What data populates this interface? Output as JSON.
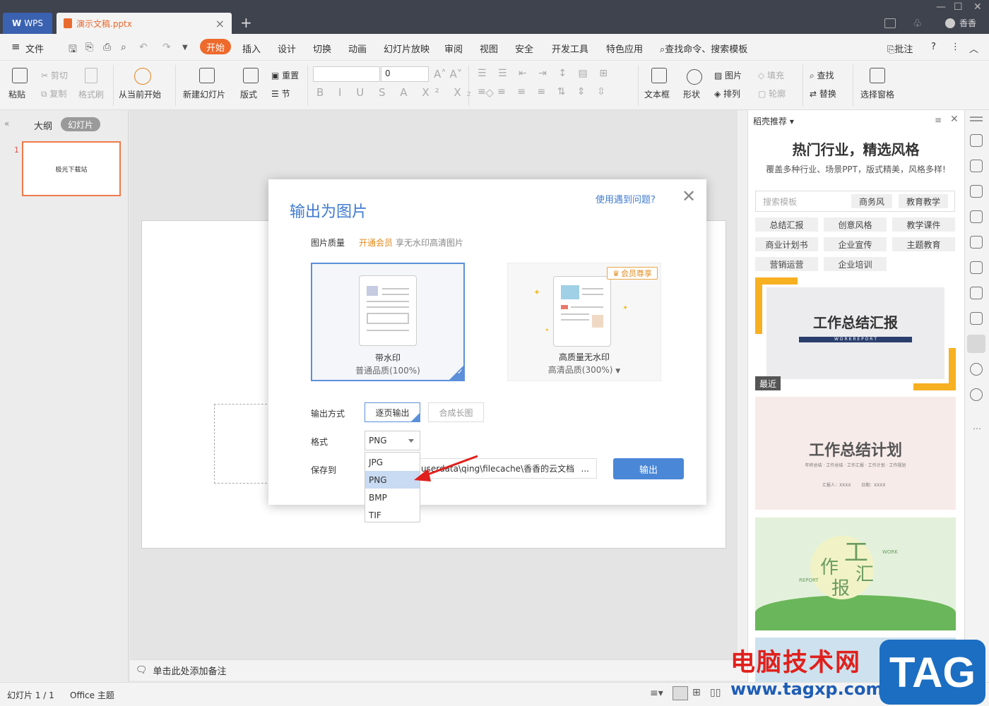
{
  "titlebar": {
    "wps_label": "WPS",
    "doc_tab": "演示文稿.pptx",
    "user": "香香"
  },
  "menu": {
    "file": "文件",
    "items": [
      "开始",
      "插入",
      "设计",
      "切换",
      "动画",
      "幻灯片放映",
      "审阅",
      "视图",
      "安全",
      "开发工具",
      "特色应用"
    ],
    "search": "查找命令、搜索模板",
    "comment": "批注"
  },
  "toolbar": {
    "paste": "粘贴",
    "cut": "剪切",
    "copy": "复制",
    "format_painter": "格式刷",
    "from_start": "从当前开始",
    "new_slide": "新建幻灯片",
    "layout": "版式",
    "reset": "重置",
    "section": "节",
    "font_size": "0",
    "textbox": "文本框",
    "shape": "形状",
    "picture": "图片",
    "arrange": "排列",
    "fill": "填充",
    "outline": "轮廓",
    "find": "查找",
    "replace": "替换",
    "select_pane": "选择窗格"
  },
  "leftpane": {
    "tab_outline": "大纲",
    "tab_slides": "幻灯片",
    "slide_num": "1",
    "thumb_text": "极光下载站"
  },
  "notes": "单击此处添加备注",
  "rightpanel": {
    "header": "稻壳推荐",
    "title": "热门行业，精选风格",
    "subtitle": "覆盖多种行业、场景PPT，版式精美，风格多样!",
    "search_placeholder": "搜索模板",
    "search_chips": [
      "商务风",
      "教育教学"
    ],
    "categories": [
      "总结汇报",
      "创意风格",
      "教学课件",
      "商业计划书",
      "企业宣传",
      "主题教育",
      "营销运营",
      "企业培训"
    ],
    "card1_title": "工作总结汇报",
    "card1_sub": "W O R K   R E P O R T",
    "card1_badge": "最近",
    "card2_title": "工作总结计划",
    "card2_sub": "年终总结 · 工作总结 · 工作汇报 · 工作计划 · 工作规划",
    "card2_reporter": "汇报人：XXXX",
    "card2_date": "日期：XXXX",
    "card3_chars": [
      "工",
      "作",
      "汇",
      "报"
    ],
    "card3_work": "WORK",
    "card3_report": "REPORT"
  },
  "status": {
    "slide_info": "幻灯片 1 / 1",
    "theme": "Office 主题"
  },
  "dialog": {
    "title": "输出为图片",
    "help": "使用遇到问题?",
    "quality_label": "图片质量",
    "vip_link": "开通会员",
    "vip_desc": "享无水印高清图片",
    "opt1_title": "带水印",
    "opt1_sub": "普通品质(100%)",
    "opt2_title": "高质量无水印",
    "opt2_sub": "高清品质(300%)",
    "vip_badge": "会员尊享",
    "mode_label": "输出方式",
    "mode1": "逐页输出",
    "mode2": "合成长图",
    "format_label": "格式",
    "format_value": "PNG",
    "format_options": [
      "JPG",
      "PNG",
      "BMP",
      "TIF"
    ],
    "save_label": "保存到",
    "save_path": "userdata\\qing\\filecache\\香香的云文档\\",
    "path_more": "...",
    "export_button": "输出"
  },
  "watermark": {
    "text": "电脑技术网",
    "url": "www.tagxp.com",
    "tag": "TAG"
  },
  "colors": {
    "accent": "#ee6a2b",
    "dialog_blue": "#3f7bd0",
    "titlebar": "#3f434e"
  }
}
